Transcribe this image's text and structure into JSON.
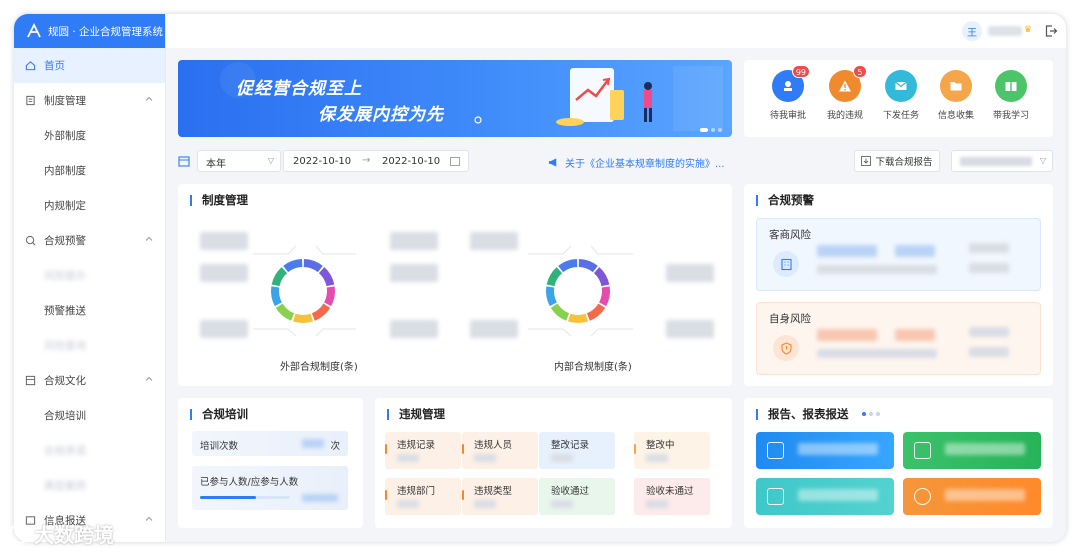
{
  "app": {
    "title": "规圆 · 企业合规管理系统"
  },
  "sidebar": {
    "home": "首页",
    "groups": [
      {
        "label": "制度管理",
        "items": [
          "外部制度",
          "内部制度",
          "内规制定"
        ]
      },
      {
        "label": "合规预警",
        "items": [
          "风险督办",
          "预警推送",
          "风险查询"
        ]
      },
      {
        "label": "合规文化",
        "items": [
          "合规培训",
          "合规承诺",
          "典型案例"
        ]
      },
      {
        "label": "信息报送",
        "items": []
      }
    ]
  },
  "topbar": {
    "avatar_initial": "王"
  },
  "banner": {
    "line1": "促经营合规至上",
    "line2": "保发展内控为先"
  },
  "quick_actions": [
    {
      "label": "待我审批",
      "badge": "99",
      "color": "#2f7cf6"
    },
    {
      "label": "我的违规",
      "badge": "5",
      "color": "#f08a2e"
    },
    {
      "label": "下发任务",
      "badge": "",
      "color": "#33b9d9"
    },
    {
      "label": "信息收集",
      "badge": "",
      "color": "#f5a64a"
    },
    {
      "label": "带我学习",
      "badge": "",
      "color": "#4cc46a"
    }
  ],
  "filters": {
    "period": "本年",
    "date_start": "2022-10-10",
    "date_arrow": "→",
    "date_end": "2022-10-10",
    "notice": "关于《企业基本规章制度的实施》...",
    "download_label": "下载合规报告"
  },
  "system_card": {
    "title": "制度管理",
    "external_label": "外部合规制度(条)",
    "internal_label": "内部合规制度(条)",
    "donut_colors": [
      "#5b6ee6",
      "#7e57d9",
      "#e64bb0",
      "#f26a4b",
      "#f6c23a",
      "#8ad04f",
      "#3ba3e8",
      "#2fb37a",
      "#4a7cf0"
    ]
  },
  "warning_card": {
    "title": "合规预警",
    "customer_risk": "客商风险",
    "self_risk": "自身风险"
  },
  "training_card": {
    "title": "合规培训",
    "count_label": "培训次数",
    "count_unit": "次",
    "participation_label": "已参与人数/应参与人数",
    "progress": 0.62
  },
  "violation_card": {
    "title": "违规管理",
    "tiles": [
      {
        "label": "违规记录",
        "bg": "#fdf0e6",
        "bar": "#f08a2e"
      },
      {
        "label": "违规人员",
        "bg": "#fdf0e6",
        "bar": "#f08a2e"
      },
      {
        "label": "整改记录",
        "bg": "#e6f1fd",
        "bar": ""
      },
      {
        "label": "整改中",
        "bg": "#fdf3e6",
        "bar": "#f5a64a"
      },
      {
        "label": "违规部门",
        "bg": "#fdf0e6",
        "bar": "#f08a2e"
      },
      {
        "label": "违规类型",
        "bg": "#fdf0e6",
        "bar": "#f08a2e"
      },
      {
        "label": "验收通过",
        "bg": "#e8f6ec",
        "bar": ""
      },
      {
        "label": "验收未通过",
        "bg": "#fdeaea",
        "bar": ""
      }
    ]
  },
  "report_card": {
    "title": "报告、报表报送",
    "tile_colors": [
      "#2d8cf0",
      "#3bc26a",
      "#3fc7c9",
      "#f5963a"
    ]
  },
  "watermark": "大数跨境"
}
